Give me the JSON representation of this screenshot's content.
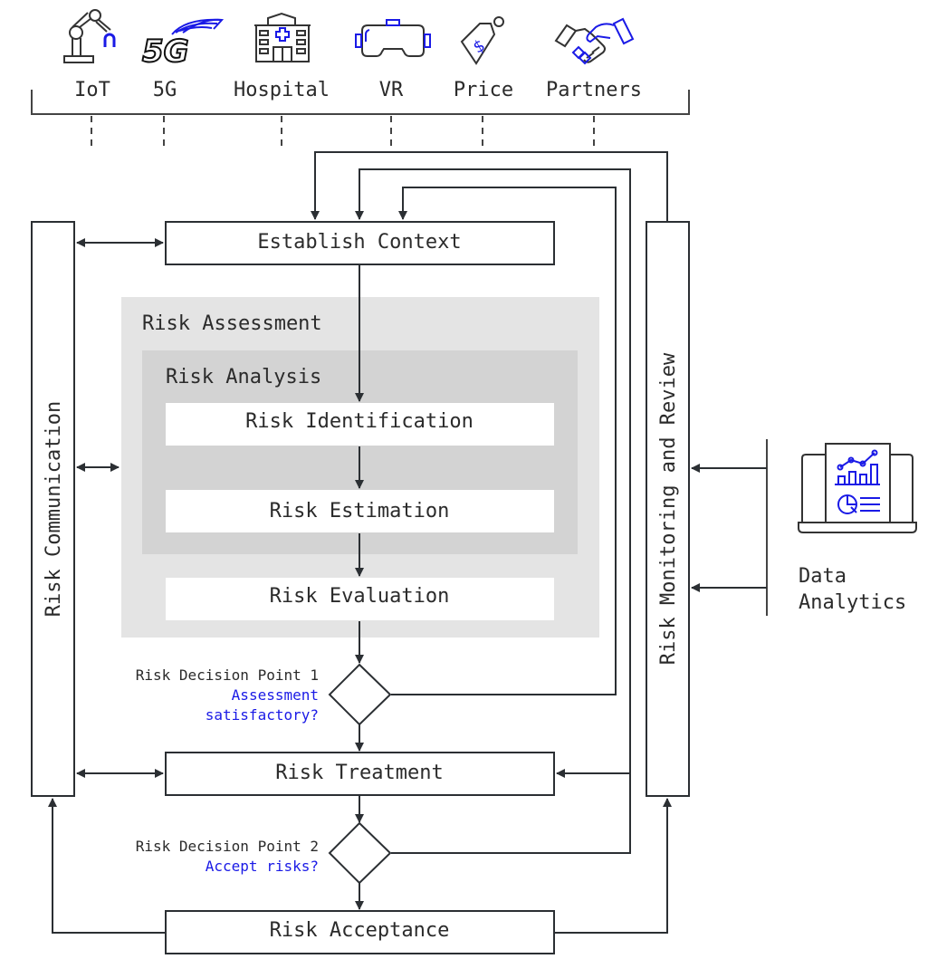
{
  "colors": {
    "line": "#2b2f33",
    "accent_blue": "#1a1ae6",
    "assessment_bg": "#e4e4e4",
    "analysis_bg": "#d3d3d3",
    "box_bg": "#ffffff"
  },
  "top_factors": [
    {
      "label": "IoT",
      "icon": "robot-arm-icon"
    },
    {
      "label": "5G",
      "icon": "5g-signal-icon"
    },
    {
      "label": "Hospital",
      "icon": "hospital-icon"
    },
    {
      "label": "VR",
      "icon": "vr-headset-icon"
    },
    {
      "label": "Price",
      "icon": "price-tag-icon"
    },
    {
      "label": "Partners",
      "icon": "handshake-icon"
    }
  ],
  "process": {
    "establish_context": "Establish Context",
    "risk_assessment": "Risk Assessment",
    "risk_analysis": "Risk Analysis",
    "risk_identification": "Risk Identification",
    "risk_estimation": "Risk Estimation",
    "risk_evaluation": "Risk Evaluation",
    "risk_treatment": "Risk Treatment",
    "risk_acceptance": "Risk Acceptance"
  },
  "decisions": [
    {
      "title": "Risk Decision Point 1",
      "question_line1": "Assessment",
      "question_line2": "satisfactory?"
    },
    {
      "title": "Risk Decision Point 2",
      "question_line1": "Accept risks?"
    }
  ],
  "side": {
    "communication": "Risk Communication",
    "monitoring": "Risk Monitoring and Review"
  },
  "data_analytics": {
    "line1": "Data",
    "line2": "Analytics",
    "icon": "data-analytics-laptop-icon"
  }
}
